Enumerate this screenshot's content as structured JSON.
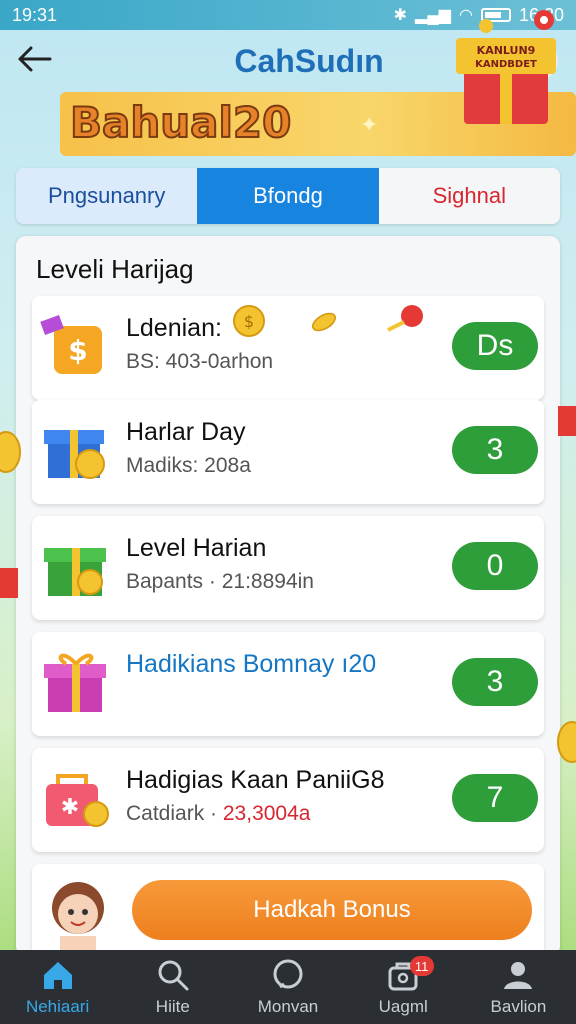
{
  "status_bar": {
    "time_left": "19:31",
    "time_right": "16:20"
  },
  "app_bar": {
    "title": "CahSudın"
  },
  "banner": {
    "text": "Bahual20",
    "gift_text": "KANLUN9 KANDBDET"
  },
  "tabs": [
    {
      "label": "Pngsunanry"
    },
    {
      "label": "Bfondg"
    },
    {
      "label": "Sighnal"
    }
  ],
  "panel": {
    "title": "Leveli Harijag"
  },
  "cards": [
    {
      "title": "Ldenian:",
      "subtitle": "BS: 403-0arhon",
      "value": "Ds",
      "icon": "dollar-bag-icon"
    },
    {
      "title": "Harlar Day",
      "subtitle": "Madiks: 208a",
      "value": "3",
      "icon": "blue-gift-icon"
    },
    {
      "title": "Level Harian",
      "subtitle": "Bapants · 21:8894in",
      "value": "0",
      "icon": "green-gift-icon"
    },
    {
      "title": "Hadikians Bomnay ı20",
      "subtitle": "",
      "value": "3",
      "icon": "pink-gift-icon"
    },
    {
      "title": "Hadigias Kaan PaniiG8",
      "subtitle_prefix": "Catdiark ·",
      "subtitle_red": "23,3004a",
      "value": "7",
      "icon": "red-bag-icon"
    }
  ],
  "bonus": {
    "button_label": "Hadkah Bonus"
  },
  "nav": [
    {
      "label": "Nehiaari",
      "icon": "home-icon",
      "active": true
    },
    {
      "label": "Hiite",
      "icon": "search-icon"
    },
    {
      "label": "Monvan",
      "icon": "chat-icon"
    },
    {
      "label": "Uagml",
      "icon": "bag-icon",
      "badge": "11"
    },
    {
      "label": "Bavlion",
      "icon": "profile-icon"
    }
  ],
  "colors": {
    "primary": "#1784e0",
    "accent": "#2e9e3a",
    "bonus": "#ee7f1e",
    "nav_bg": "#2b2f34"
  }
}
